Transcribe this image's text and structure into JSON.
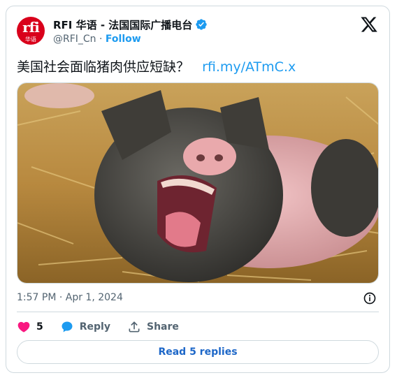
{
  "author": {
    "display_name": "RFI 华语 - 法国国际广播电台",
    "handle": "@RFI_Cn",
    "separator": "·",
    "follow_label": "Follow",
    "avatar_logo": "rfi",
    "avatar_sub": "华语"
  },
  "tweet": {
    "text": "美国社会面临猪肉供应短缺？",
    "link": "rfi.my/ATmC.x",
    "timestamp": "1:57 PM · Apr 1, 2024"
  },
  "actions": {
    "likes_count": "5",
    "reply_label": "Reply",
    "share_label": "Share"
  },
  "footer": {
    "read_replies_label": "Read 5 replies"
  },
  "colors": {
    "accent": "#1d9bf0",
    "like": "#f91880",
    "brand_red": "#d9001b",
    "muted": "#536471",
    "border": "#cfd9de"
  },
  "icons": [
    "verified-badge-icon",
    "x-logo-icon",
    "info-icon",
    "heart-icon",
    "reply-bubble-icon",
    "share-icon"
  ]
}
